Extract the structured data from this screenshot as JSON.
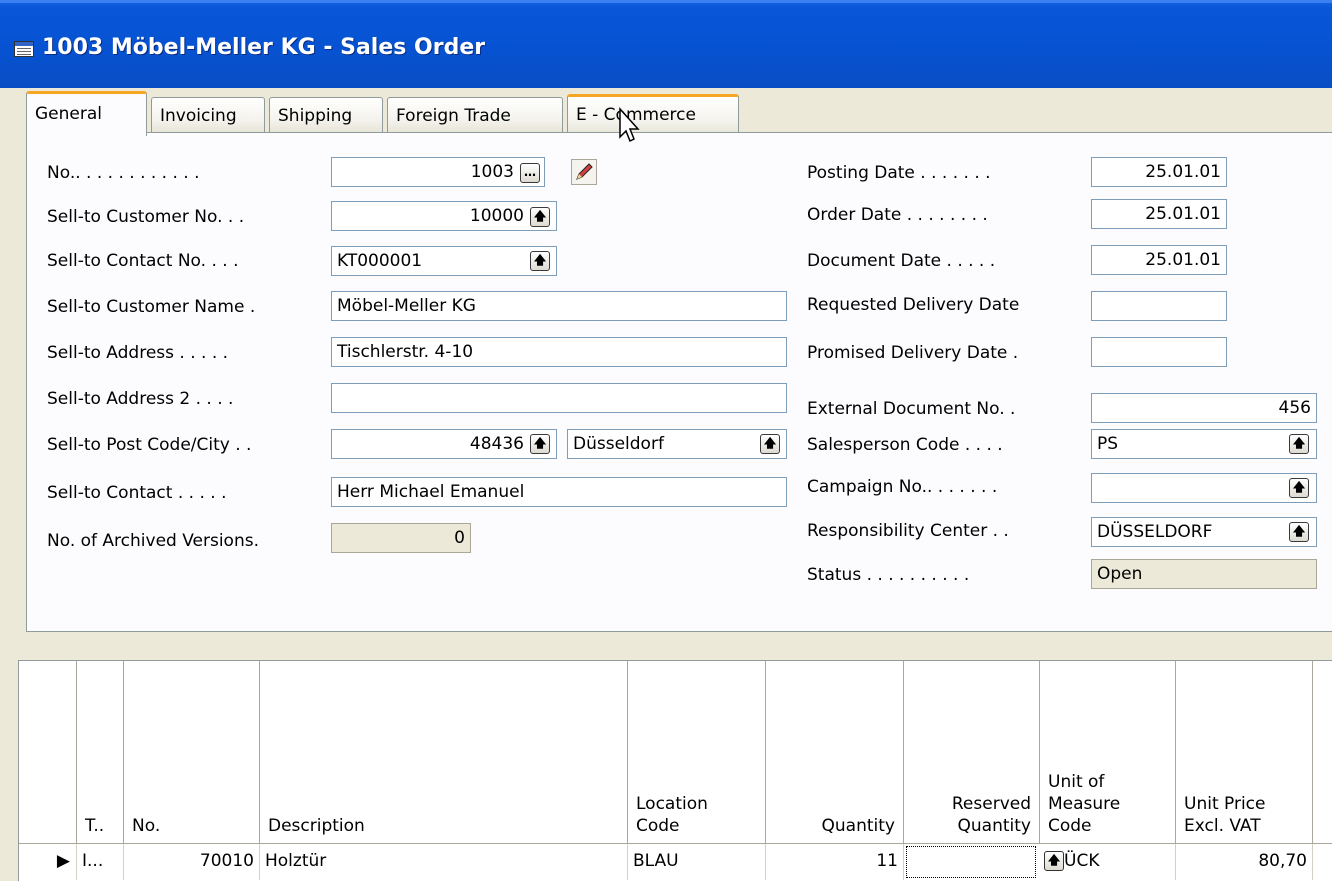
{
  "window": {
    "title": "1003 Möbel-Meller KG - Sales Order"
  },
  "tabs": [
    {
      "label": "General",
      "active": true
    },
    {
      "label": "Invoicing"
    },
    {
      "label": "Shipping"
    },
    {
      "label": "Foreign Trade"
    },
    {
      "label": "E - Commerce"
    }
  ],
  "left_fields": {
    "no": {
      "label": "No.. . . . . . . . . . . .",
      "value": "1003"
    },
    "sell_to_customer_no": {
      "label": "Sell-to Customer No. . .",
      "value": "10000"
    },
    "sell_to_contact_no": {
      "label": "Sell-to Contact No. . . .",
      "value": "KT000001"
    },
    "sell_to_customer_name": {
      "label": "Sell-to Customer Name .",
      "value": "Möbel-Meller KG"
    },
    "sell_to_address": {
      "label": "Sell-to Address . . . . .",
      "value": "Tischlerstr. 4-10"
    },
    "sell_to_address_2": {
      "label": "Sell-to Address 2 . . . .",
      "value": ""
    },
    "sell_to_post_code_city": {
      "label": "Sell-to Post Code/City . .",
      "post_code": "48436",
      "city": "Düsseldorf"
    },
    "sell_to_contact": {
      "label": "Sell-to Contact . . . . .",
      "value": "Herr Michael Emanuel"
    },
    "no_archived_versions": {
      "label": "No. of Archived Versions.",
      "value": "0"
    }
  },
  "right_fields": {
    "posting_date": {
      "label": "Posting Date . . . . . . .",
      "value": "25.01.01"
    },
    "order_date": {
      "label": "Order Date . . . . . . . .",
      "value": "25.01.01"
    },
    "document_date": {
      "label": "Document Date . . . . .",
      "value": "25.01.01"
    },
    "requested_delivery_date": {
      "label": "Requested Delivery Date",
      "value": ""
    },
    "promised_delivery_date": {
      "label": "Promised Delivery Date .",
      "value": ""
    },
    "external_document_no": {
      "label": "External Document No. .",
      "value": "456"
    },
    "salesperson_code": {
      "label": "Salesperson Code . . . .",
      "value": "PS"
    },
    "campaign_no": {
      "label": "Campaign No.. . . . . . .",
      "value": ""
    },
    "responsibility_center": {
      "label": "Responsibility Center . .",
      "value": "DÜSSELDORF"
    },
    "status": {
      "label": "Status . . . . . . . . . .",
      "value": "Open"
    }
  },
  "lines": {
    "headers": {
      "type": "T..",
      "no": "No.",
      "description": "Description",
      "location_code": [
        "Location",
        "Code"
      ],
      "quantity": "Quantity",
      "reserved_quantity": [
        "Reserved",
        "Quantity"
      ],
      "unit_of_measure_code": [
        "Unit of",
        "Measure",
        "Code"
      ],
      "unit_price": [
        "Unit Price",
        "Excl. VAT"
      ]
    },
    "rows": [
      {
        "type": "I...",
        "no": "70010",
        "description": "Holztür",
        "location_code": "BLAU",
        "quantity": "11",
        "reserved_quantity": "",
        "unit_of_measure_code": "ÜCK",
        "unit_price": "80,70"
      }
    ]
  },
  "colors": {
    "titlebar": "#0653d4",
    "tab_accent": "#f5a623",
    "field_border": "#7f9db9"
  }
}
